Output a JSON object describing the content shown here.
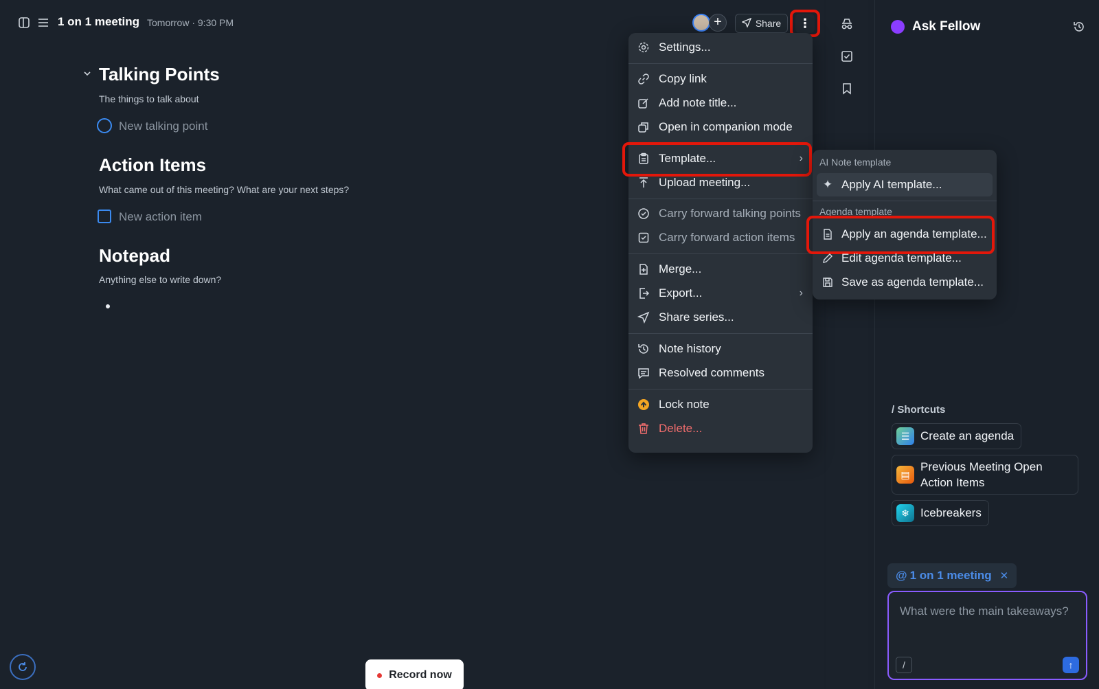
{
  "header": {
    "title": "1 on 1 meeting",
    "subtitle": "Tomorrow · 9:30 PM",
    "share_label": "Share"
  },
  "sections": {
    "talking_points": {
      "title": "Talking Points",
      "description": "The things to talk about",
      "placeholder": "New talking point"
    },
    "action_items": {
      "title": "Action Items",
      "description": "What came out of this meeting? What are your next steps?",
      "placeholder": "New action item"
    },
    "notepad": {
      "title": "Notepad",
      "description": "Anything else to write down?"
    }
  },
  "record_label": "Record now",
  "menu": {
    "items": [
      {
        "label": "Settings...",
        "icon": "gear-icon"
      },
      {
        "label": "Copy link",
        "icon": "link-icon"
      },
      {
        "label": "Add note title...",
        "icon": "edit-icon"
      },
      {
        "label": "Open in companion mode",
        "icon": "windows-icon"
      },
      {
        "label": "Template...",
        "icon": "clipboard-icon"
      },
      {
        "label": "Upload meeting...",
        "icon": "upload-icon"
      },
      {
        "label": "Carry forward talking points",
        "icon": "check-circle-icon"
      },
      {
        "label": "Carry forward action items",
        "icon": "check-square-icon"
      },
      {
        "label": "Merge...",
        "icon": "merge-file-icon"
      },
      {
        "label": "Export...",
        "icon": "export-icon"
      },
      {
        "label": "Share series...",
        "icon": "send-icon"
      },
      {
        "label": "Note history",
        "icon": "history-icon"
      },
      {
        "label": "Resolved comments",
        "icon": "comment-icon"
      },
      {
        "label": "Lock note",
        "icon": "lock-upgrade-icon"
      },
      {
        "label": "Delete...",
        "icon": "trash-icon"
      }
    ]
  },
  "submenu": {
    "ai_header": "AI Note template",
    "ai_item": "Apply AI template...",
    "agenda_header": "Agenda template",
    "agenda_items": [
      "Apply an agenda template...",
      "Edit agenda template...",
      "Save as agenda template..."
    ]
  },
  "right_panel": {
    "title": "Ask Fellow",
    "shortcuts_header": "/ Shortcuts",
    "shortcuts": [
      {
        "label": "Create an agenda",
        "color": "#3aa3a0"
      },
      {
        "label": "Previous Meeting Open Action Items",
        "color": "#f08a24"
      },
      {
        "label": "Icebreakers",
        "color": "#14b8c4"
      }
    ],
    "mention": "1 on 1 meeting",
    "mention_prefix": "@",
    "input_placeholder": "What were the main takeaways?"
  },
  "colors": {
    "accent": "#3b8af0",
    "highlight": "#e3170a",
    "brand": "#8b3dff"
  }
}
